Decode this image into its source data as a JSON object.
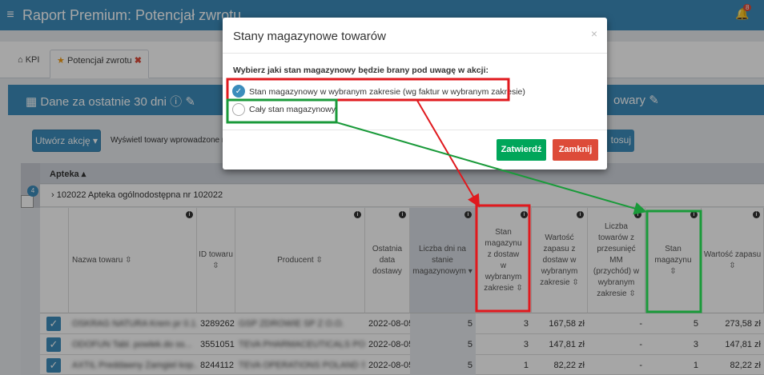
{
  "app": {
    "title": "Raport Premium: Potencjał zwrotu",
    "menu_icon": "hamburger-icon",
    "notification_icon": "bell-icon",
    "notification_count": "8"
  },
  "tabs": {
    "kpi": "KPI",
    "active": "Potencjał zwrotu"
  },
  "infobar": {
    "period": "Dane za ostatnie 30 dni",
    "right_text": "owary"
  },
  "toolbar": {
    "create_action": "Utwórz akcję",
    "filter_text": "Wyświetl towary wprowadzone na",
    "apply_fragment": "tosuj"
  },
  "grid": {
    "group_header": "Apteka",
    "group_count": "4",
    "group_row": "102022 Apteka ogólnodostępna nr 102022",
    "columns": [
      "Nazwa towaru",
      "ID towaru",
      "Producent",
      "Ostatnia data dostawy",
      "Liczba dni na stanie magazynowym",
      "Stan magazynu z dostaw w wybranym zakresie",
      "Wartość zapasu z dostaw w wybranym zakresie",
      "Liczba towarów z przesunięć MM (przychód) w wybranym zakresie",
      "Stan magazynu",
      "Wartość zapasu"
    ],
    "rows": [
      {
        "name": "OSKRAG NATURA Krem pr 0.1...",
        "id": "3289262",
        "producer": "GSP ZDROWIE SP Z O.O.",
        "date": "2022-08-05",
        "days": "5",
        "stock_range": "3",
        "value_range": "167,58 zł",
        "mm": "-",
        "stock": "5",
        "value": "273,58 zł"
      },
      {
        "name": "ODOFUN Tabl. powlek.do ss...",
        "id": "3551051",
        "producer": "TEVA PHARMACEUTICALS POLSK...",
        "date": "2022-08-05",
        "days": "5",
        "stock_range": "3",
        "value_range": "147,81 zł",
        "mm": "-",
        "stock": "3",
        "value": "147,81 zł"
      },
      {
        "name": "AXTIL Preddawny Zamgiel kop...",
        "id": "8244112",
        "producer": "TEVA OPERATIONS POLAND SP Z...",
        "date": "2022-08-05",
        "days": "5",
        "stock_range": "1",
        "value_range": "82,22 zł",
        "mm": "-",
        "stock": "1",
        "value": "82,22 zł"
      }
    ]
  },
  "modal": {
    "title": "Stany magazynowe towarów",
    "close": "×",
    "question": "Wybierz jaki stan magazynowy będzie brany pod uwagę w akcji:",
    "option1": "Stan magazynowy w wybranym zakresie (wg faktur w wybranym zakresie)",
    "option2": "Cały stan magazynowy",
    "confirm": "Zatwierdź",
    "cancel": "Zamknij"
  },
  "colors": {
    "primary": "#3c8dbc",
    "success": "#00a65a",
    "danger": "#dd4b39",
    "annotation_red": "#e0191e",
    "annotation_green": "#1a9a3a"
  }
}
